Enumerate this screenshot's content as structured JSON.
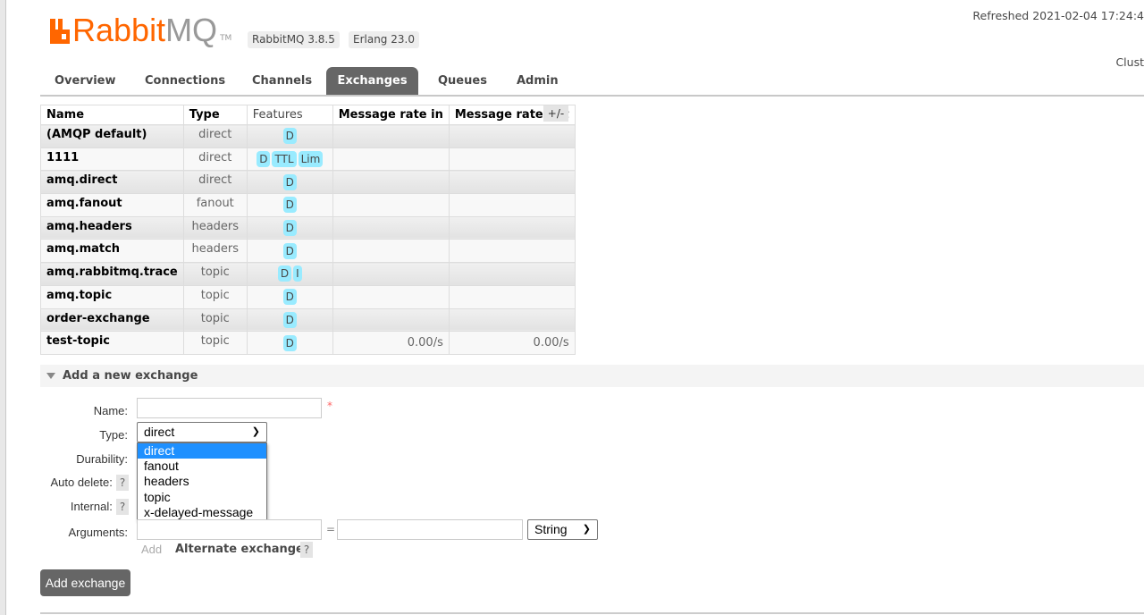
{
  "header": {
    "logo_text_1": "Rabbit",
    "logo_text_2": "MQ",
    "logo_tm": "TM",
    "version": "RabbitMQ 3.8.5",
    "erlang": "Erlang 23.0",
    "refreshed": "Refreshed 2021-02-04 17:24:4",
    "cluster": "Clust"
  },
  "tabs": [
    {
      "label": "Overview"
    },
    {
      "label": "Connections"
    },
    {
      "label": "Channels"
    },
    {
      "label": "Exchanges",
      "active": true
    },
    {
      "label": "Queues"
    },
    {
      "label": "Admin"
    }
  ],
  "table": {
    "headers": [
      "Name",
      "Type",
      "Features",
      "Message rate in",
      "Message rate out"
    ],
    "toggle": "+/-",
    "rows": [
      {
        "name": "(AMQP default)",
        "type": "direct",
        "features": [
          "D"
        ],
        "rate_in": "",
        "rate_out": ""
      },
      {
        "name": "1111",
        "type": "direct",
        "features": [
          "D",
          "TTL",
          "Lim"
        ],
        "rate_in": "",
        "rate_out": ""
      },
      {
        "name": "amq.direct",
        "type": "direct",
        "features": [
          "D"
        ],
        "rate_in": "",
        "rate_out": ""
      },
      {
        "name": "amq.fanout",
        "type": "fanout",
        "features": [
          "D"
        ],
        "rate_in": "",
        "rate_out": ""
      },
      {
        "name": "amq.headers",
        "type": "headers",
        "features": [
          "D"
        ],
        "rate_in": "",
        "rate_out": ""
      },
      {
        "name": "amq.match",
        "type": "headers",
        "features": [
          "D"
        ],
        "rate_in": "",
        "rate_out": ""
      },
      {
        "name": "amq.rabbitmq.trace",
        "type": "topic",
        "features": [
          "D",
          "I"
        ],
        "rate_in": "",
        "rate_out": ""
      },
      {
        "name": "amq.topic",
        "type": "topic",
        "features": [
          "D"
        ],
        "rate_in": "",
        "rate_out": ""
      },
      {
        "name": "order-exchange",
        "type": "topic",
        "features": [
          "D"
        ],
        "rate_in": "",
        "rate_out": ""
      },
      {
        "name": "test-topic",
        "type": "topic",
        "features": [
          "D"
        ],
        "rate_in": "0.00/s",
        "rate_out": "0.00/s"
      }
    ]
  },
  "form": {
    "section_title": "Add a new exchange",
    "name_label": "Name:",
    "name_value": "",
    "required": "*",
    "type_label": "Type:",
    "type_value": "direct",
    "type_options": [
      "direct",
      "fanout",
      "headers",
      "topic",
      "x-delayed-message"
    ],
    "durability_label": "Durability:",
    "auto_delete_label": "Auto delete:",
    "internal_label": "Internal:",
    "help": "?",
    "arguments_label": "Arguments:",
    "arg_eq": "=",
    "arg_type": "String",
    "add_link": "Add",
    "alternate_exchange": "Alternate exchange",
    "submit": "Add exchange"
  }
}
